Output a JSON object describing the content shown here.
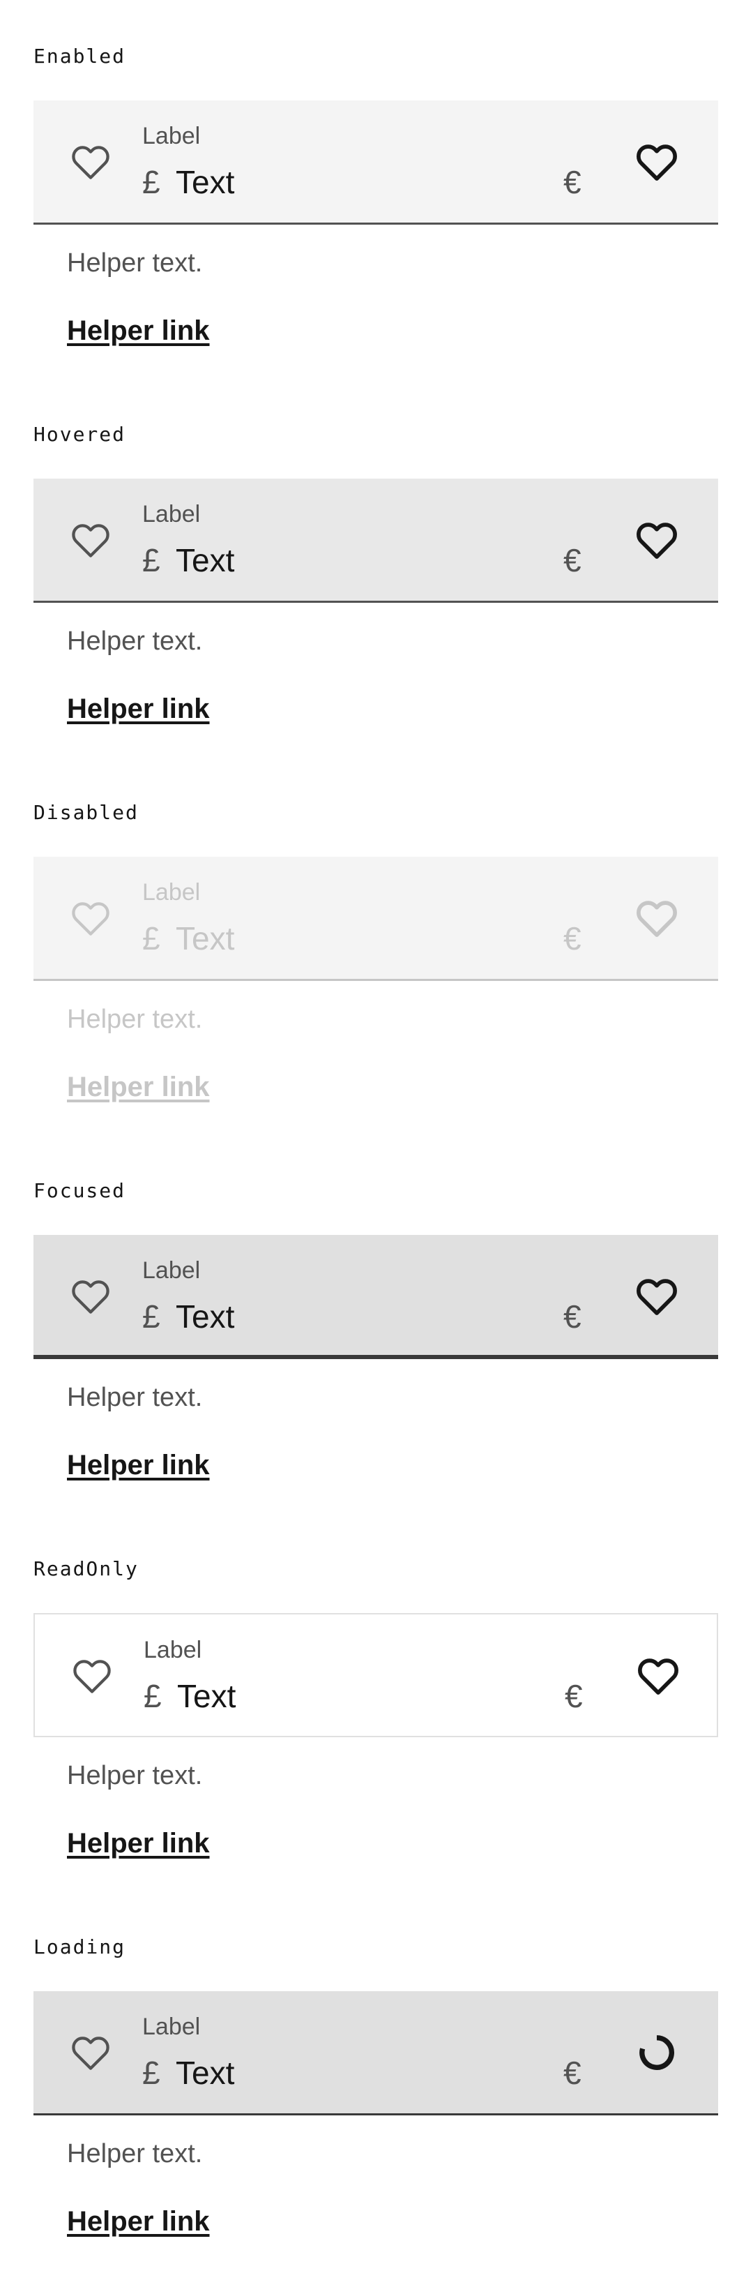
{
  "icons": {
    "lead": "heart-outline-icon",
    "trail": "heart-outline-icon",
    "loading": "spinner-icon"
  },
  "colors": {
    "text": "#161616",
    "secondary": "#525252",
    "disabled": "#c6c6c6",
    "hover_bg": "#e8e8e8",
    "field_bg": "#f4f4f4",
    "focus_bg": "#e0e0e0"
  },
  "states": [
    {
      "name": "Enabled",
      "label": "Label",
      "prefix": "£",
      "value": "Text",
      "suffix": "€",
      "helper_text": "Helper text.",
      "helper_link": "Helper link"
    },
    {
      "name": "Hovered",
      "label": "Label",
      "prefix": "£",
      "value": "Text",
      "suffix": "€",
      "helper_text": "Helper text.",
      "helper_link": "Helper link"
    },
    {
      "name": "Disabled",
      "label": "Label",
      "prefix": "£",
      "value": "Text",
      "suffix": "€",
      "helper_text": "Helper text.",
      "helper_link": "Helper link"
    },
    {
      "name": "Focused",
      "label": "Label",
      "prefix": "£",
      "value": "Text",
      "suffix": "€",
      "helper_text": "Helper text.",
      "helper_link": "Helper link"
    },
    {
      "name": "ReadOnly",
      "label": "Label",
      "prefix": "£",
      "value": "Text",
      "suffix": "€",
      "helper_text": "Helper text.",
      "helper_link": "Helper link"
    },
    {
      "name": "Loading",
      "label": "Label",
      "prefix": "£",
      "value": "Text",
      "suffix": "€",
      "helper_text": "Helper text.",
      "helper_link": "Helper link"
    }
  ]
}
